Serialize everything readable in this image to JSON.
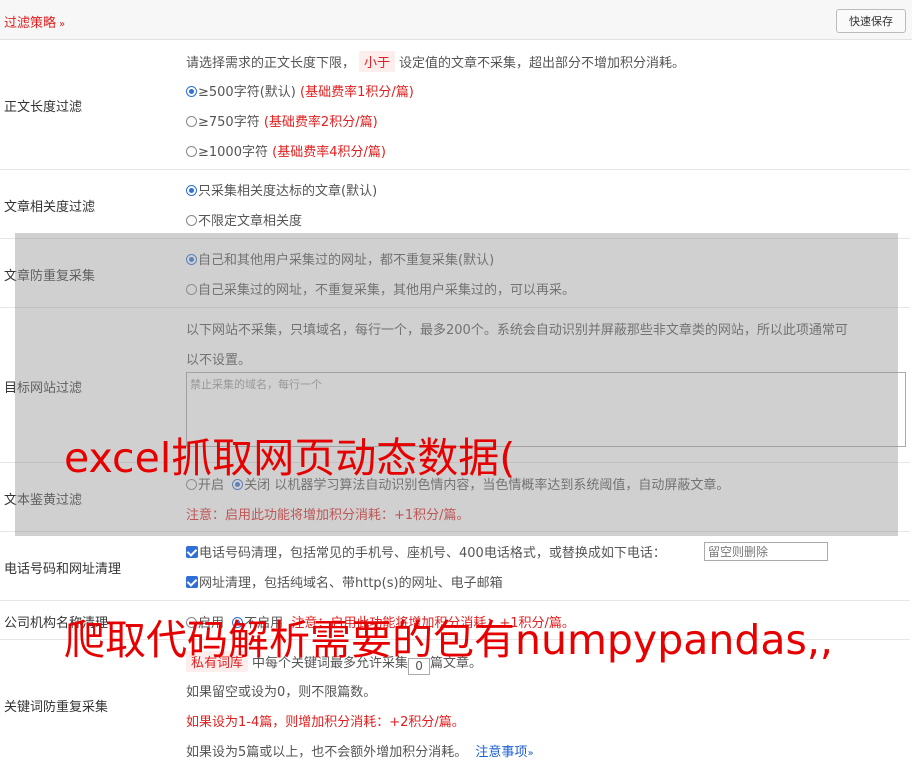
{
  "header": {
    "title": "过滤策略",
    "chevron": "»",
    "save_label": "快速保存"
  },
  "length_filter": {
    "label": "正文长度过滤",
    "desc_before": "请选择需求的正文长度下限，",
    "desc_tag": "小于",
    "desc_after": "设定值的文章不采集，超出部分不增加积分消耗。",
    "options": [
      {
        "text": "≥500字符(默认)",
        "note": "(基础费率1积分/篇)",
        "selected": true
      },
      {
        "text": "≥750字符",
        "note": "(基础费率2积分/篇)",
        "selected": false
      },
      {
        "text": "≥1000字符",
        "note": "(基础费率4积分/篇)",
        "selected": false
      }
    ]
  },
  "relevance_filter": {
    "label": "文章相关度过滤",
    "options": [
      {
        "text": "只采集相关度达标的文章(默认)",
        "selected": true
      },
      {
        "text": "不限定文章相关度",
        "selected": false
      }
    ]
  },
  "dedup_filter": {
    "label": "文章防重复采集",
    "options": [
      {
        "text": "自己和其他用户采集过的网址，都不重复采集(默认)",
        "selected": true
      },
      {
        "text": "自己采集过的网址，不重复采集，其他用户采集过的，可以再采。",
        "selected": false
      }
    ]
  },
  "site_filter": {
    "label": "目标网站过滤",
    "desc_line1": "以下网站不采集，只填域名，每行一个，最多200个。系统会自动识别并屏蔽那些非文章类的网站，所以此项通常可",
    "desc_line2": "以不设置。",
    "placeholder": "禁止采集的域名，每行一个"
  },
  "porn_filter": {
    "label": "文本鉴黄过滤",
    "on_label": "开启",
    "off_label": "关闭",
    "desc": "以机器学习算法自动识别色情内容，当色情概率达到系统阈值，自动屏蔽文章。",
    "note": "注意：启用此功能将增加积分消耗：+1积分/篇。"
  },
  "phone_clean": {
    "label": "电话号码和网址清理",
    "phone_text": "电话号码清理，包括常见的手机号、座机号、400电话格式，或替换成如下电话：",
    "phone_placeholder": "留空则删除",
    "url_text": "网址清理，包括纯域名、带http(s)的网址、电子邮箱"
  },
  "org_clean": {
    "label": "公司机构名称清理",
    "on_label": "启用",
    "off_label": "不启用",
    "note": "注意：启用此功能将增加积分消耗：+1积分/篇。"
  },
  "keyword_dedup": {
    "label": "关键词防重复采集",
    "tag": "私有词库",
    "line1_mid": "中每个关键词最多允许采集",
    "value": "0",
    "line1_end": "篇文章。",
    "line2": "如果留空或设为0，则不限篇数。",
    "line3": "如果设为1-4篇，则增加积分消耗：+2积分/篇。",
    "line4": "如果设为5篇或以上，也不会额外增加积分消耗。",
    "link": "注意事项",
    "link_chevron": "»"
  },
  "watermarks": {
    "line1": "excel抓取网页动态数据(",
    "line2": "爬取代码解析需要的包有numpypandas,,"
  }
}
